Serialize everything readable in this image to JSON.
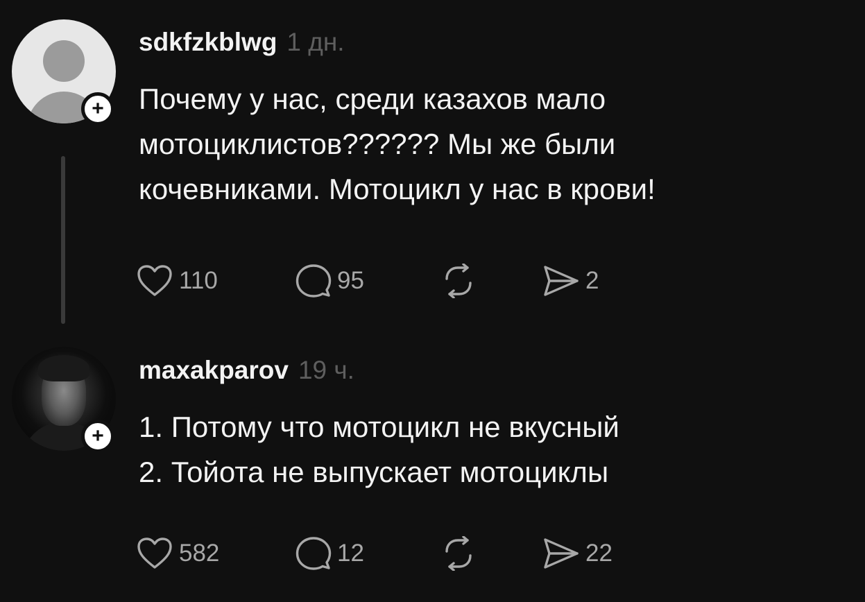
{
  "posts": [
    {
      "username": "sdkfzkblwg",
      "time": "1 дн.",
      "text": "Почему у нас, среди казахов мало\nмотоциклистов?????? Мы же были\nкочевниками. Мотоцикл у нас в крови!",
      "likes": "110",
      "comments": "95",
      "shares": "2",
      "avatar": "default-avatar-icon",
      "follow_icon": "+"
    },
    {
      "username": "maxakparov",
      "time": "19 ч.",
      "text": "1. Потому что мотоцикл не вкусный\n2. Тойота не выпускает мотоциклы",
      "likes": "582",
      "comments": "12",
      "shares": "22",
      "avatar": "user-photo",
      "follow_icon": "+"
    }
  ],
  "icons": {
    "like": "heart-icon",
    "comment": "comment-bubble-icon",
    "repost": "repost-icon",
    "share": "send-icon"
  },
  "colors": {
    "background": "#101010",
    "text": "#f3f3f3",
    "muted": "#5e5e5e",
    "action": "#a8a8a8"
  }
}
